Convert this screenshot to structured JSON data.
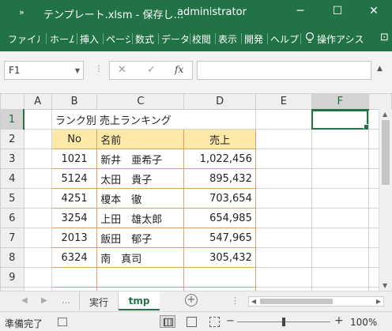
{
  "titlebar": {
    "qat_icon": "»",
    "title": "テンプレート.xlsm  -  保存し…",
    "user": "administrator",
    "min_icon": "─",
    "max_icon": "☐",
    "close_icon": "✕"
  },
  "ribbon": {
    "tabs": [
      "ファイル",
      "ホーム",
      "挿入",
      "ページ",
      "数式",
      "データ",
      "校閲",
      "表示",
      "開発",
      "ヘルプ"
    ],
    "tell_me": "操作アシス",
    "bulb_icon": "lightbulb-icon",
    "share_icon": "⊡"
  },
  "formula_bar": {
    "name_box": "F1",
    "name_dropdown": "▼",
    "dots": "⋮",
    "cancel": "✕",
    "enter": "✓",
    "fx": "fx",
    "value": "",
    "collapse": "▲"
  },
  "grid": {
    "columns": [
      "A",
      "B",
      "C",
      "D",
      "E",
      "F"
    ],
    "rows": [
      "1",
      "2",
      "3",
      "4",
      "5",
      "6",
      "7",
      "8",
      "9"
    ],
    "selected_column": "F",
    "selected_row": "1",
    "title_cell": "ランク別 売上ランキング",
    "header": [
      "No",
      "名前",
      "売上"
    ],
    "data": [
      [
        "1021",
        "新井　亜希子",
        "1,022,456"
      ],
      [
        "5124",
        "太田　貴子",
        "895,432"
      ],
      [
        "4251",
        "榎本　徹",
        "703,654"
      ],
      [
        "3254",
        "上田　雄太郎",
        "654,985"
      ],
      [
        "2013",
        "飯田　郁子",
        "547,965"
      ],
      [
        "6324",
        "南　真司",
        "305,432"
      ]
    ]
  },
  "sheets": {
    "tabs": [
      "実行",
      "tmp"
    ],
    "active": "tmp",
    "add": "+",
    "nav_prev": "◀",
    "nav_next": "▶",
    "ellipsis": "…",
    "ellipsis_right": "⋮"
  },
  "statusbar": {
    "ready": "準備完了",
    "zoom": "100%",
    "zoom_value": 100,
    "zoom_out": "−",
    "zoom_in": "+"
  },
  "colors": {
    "excel_green": "#217346",
    "table_header_fill": "#ffe9a8",
    "table_border": "#e0a060"
  }
}
